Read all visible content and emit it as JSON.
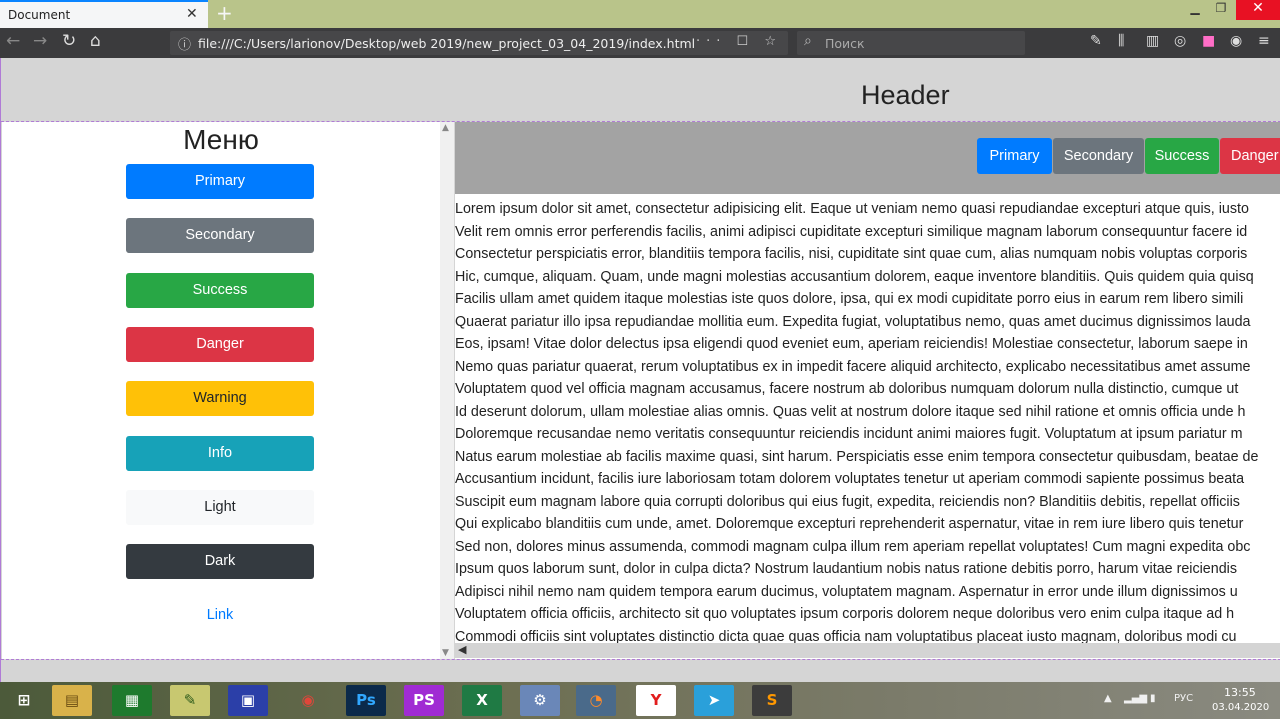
{
  "browser": {
    "tab_title": "Document",
    "tab_close": "✕",
    "new_tab": "+",
    "url": "file:///C:/Users/larionov/Desktop/web 2019/new_project_03_04_2019/index.html",
    "search_placeholder": "Поиск",
    "url_actions": "··· ☐ ☆"
  },
  "page": {
    "header_title": "Header",
    "sidebar_title": "Меню",
    "sidebar_buttons": [
      {
        "label": "Primary",
        "bg": "#007bff",
        "fg": "#ffffff"
      },
      {
        "label": "Secondary",
        "bg": "#6c757d",
        "fg": "#ffffff"
      },
      {
        "label": "Success",
        "bg": "#28a745",
        "fg": "#ffffff"
      },
      {
        "label": "Danger",
        "bg": "#dc3545",
        "fg": "#ffffff"
      },
      {
        "label": "Warning",
        "bg": "#ffc107",
        "fg": "#212529"
      },
      {
        "label": "Info",
        "bg": "#17a2b8",
        "fg": "#ffffff"
      },
      {
        "label": "Light",
        "bg": "#f8f9fa",
        "fg": "#212529"
      },
      {
        "label": "Dark",
        "bg": "#343a40",
        "fg": "#ffffff"
      },
      {
        "label": "Link",
        "bg": "transparent",
        "fg": "#007bff"
      }
    ],
    "top_buttons": [
      {
        "label": "Primary",
        "bg": "#007bff",
        "fg": "#ffffff"
      },
      {
        "label": "Secondary",
        "bg": "#6c757d",
        "fg": "#ffffff"
      },
      {
        "label": "Success",
        "bg": "#28a745",
        "fg": "#ffffff"
      },
      {
        "label": "Danger",
        "bg": "#dc3545",
        "fg": "#ffffff"
      }
    ],
    "lorem_lines": [
      "Lorem ipsum dolor sit amet, consectetur adipisicing elit. Eaque ut veniam nemo quasi repudiandae excepturi atque quis, iusto",
      "Velit rem omnis error perferendis facilis, animi adipisci cupiditate excepturi similique magnam laborum consequuntur facere id",
      "Consectetur perspiciatis error, blanditiis tempora facilis, nisi, cupiditate sint quae cum, alias numquam nobis voluptas corporis",
      "Hic, cumque, aliquam. Quam, unde magni molestias accusantium dolorem, eaque inventore blanditiis. Quis quidem quia quisq",
      "Facilis ullam amet quidem itaque molestias iste quos dolore, ipsa, qui ex modi cupiditate porro eius in earum rem libero simili",
      "Quaerat pariatur illo ipsa repudiandae mollitia eum. Expedita fugiat, voluptatibus nemo, quas amet ducimus dignissimos lauda",
      "Eos, ipsam! Vitae dolor delectus ipsa eligendi quod eveniet eum, aperiam reiciendis! Molestiae consectetur, laborum saepe in",
      "Nemo quas pariatur quaerat, rerum voluptatibus ex in impedit facere aliquid architecto, explicabo necessitatibus amet assume",
      "Voluptatem quod vel officia magnam accusamus, facere nostrum ab doloribus numquam dolorum nulla distinctio, cumque ut",
      "Id deserunt dolorum, ullam molestiae alias omnis. Quas velit at nostrum dolore itaque sed nihil ratione et omnis officia unde h",
      "Doloremque recusandae nemo veritatis consequuntur reiciendis incidunt animi maiores fugit. Voluptatum at ipsum pariatur m",
      "Natus earum molestiae ab facilis maxime quasi, sint harum. Perspiciatis esse enim tempora consectetur quibusdam, beatae de",
      "Accusantium incidunt, facilis iure laboriosam totam dolorem voluptates tenetur ut aperiam commodi sapiente possimus beata",
      "Suscipit eum magnam labore quia corrupti doloribus qui eius fugit, expedita, reiciendis non? Blanditiis debitis, repellat officiis",
      "Qui explicabo blanditiis cum unde, amet. Doloremque excepturi reprehenderit aspernatur, vitae in rem iure libero quis tenetur",
      "Sed non, dolores minus assumenda, commodi magnam culpa illum rem aperiam repellat voluptates! Cum magni expedita obc",
      "Ipsum quos laborum sunt, dolor in culpa dicta? Nostrum laudantium nobis natus ratione debitis porro, harum vitae reiciendis",
      "Adipisci nihil nemo nam quidem tempora earum ducimus, voluptatem magnam. Aspernatur in error unde illum dignissimos u",
      "Voluptatem officia officiis, architecto sit quo voluptates ipsum corporis dolorem neque doloribus vero enim culpa itaque ad h",
      "Commodi officiis sint voluptates distinctio dicta quae quas officia nam voluptatibus placeat iusto magnam, doloribus modi cu"
    ]
  },
  "taskbar": {
    "lang": "РУС",
    "time": "13:55",
    "date": "03.04.2020",
    "apps": [
      {
        "icon": "windows-start-icon",
        "glyph": "⊞",
        "bg": "transparent",
        "fg": "#ffffff"
      },
      {
        "icon": "file-explorer-icon",
        "glyph": "▤",
        "bg": "#d9b24a",
        "fg": "#6b4d12"
      },
      {
        "icon": "store-icon",
        "glyph": "▦",
        "bg": "#1e7a2d",
        "fg": "#ffffff"
      },
      {
        "icon": "chart-app-icon",
        "glyph": "✎",
        "bg": "#c8c870",
        "fg": "#2b5a1a"
      },
      {
        "icon": "save-app-icon",
        "glyph": "▣",
        "bg": "#2b3fa8",
        "fg": "#ffffff"
      },
      {
        "icon": "chrome-icon",
        "glyph": "◉",
        "bg": "transparent",
        "fg": "#e0463a"
      },
      {
        "icon": "photoshop-icon",
        "glyph": "Ps",
        "bg": "#0b2a4a",
        "fg": "#31a8ff"
      },
      {
        "icon": "phpstorm-icon",
        "glyph": "PS",
        "bg": "#a02bd3",
        "fg": "#ffffff"
      },
      {
        "icon": "excel-icon",
        "glyph": "X",
        "bg": "#1f7a44",
        "fg": "#ffffff"
      },
      {
        "icon": "control-panel-icon",
        "glyph": "⚙",
        "bg": "#6a87b8",
        "fg": "#ffffff"
      },
      {
        "icon": "firefox-icon",
        "glyph": "◔",
        "bg": "#4a6a8a",
        "fg": "#ff8b2a"
      },
      {
        "icon": "yandex-icon",
        "glyph": "Y",
        "bg": "#ffffff",
        "fg": "#e21d1d"
      },
      {
        "icon": "telegram-icon",
        "glyph": "➤",
        "bg": "#2aa0da",
        "fg": "#ffffff"
      },
      {
        "icon": "sublime-icon",
        "glyph": "S",
        "bg": "#3c3c3c",
        "fg": "#ff9800"
      }
    ]
  }
}
